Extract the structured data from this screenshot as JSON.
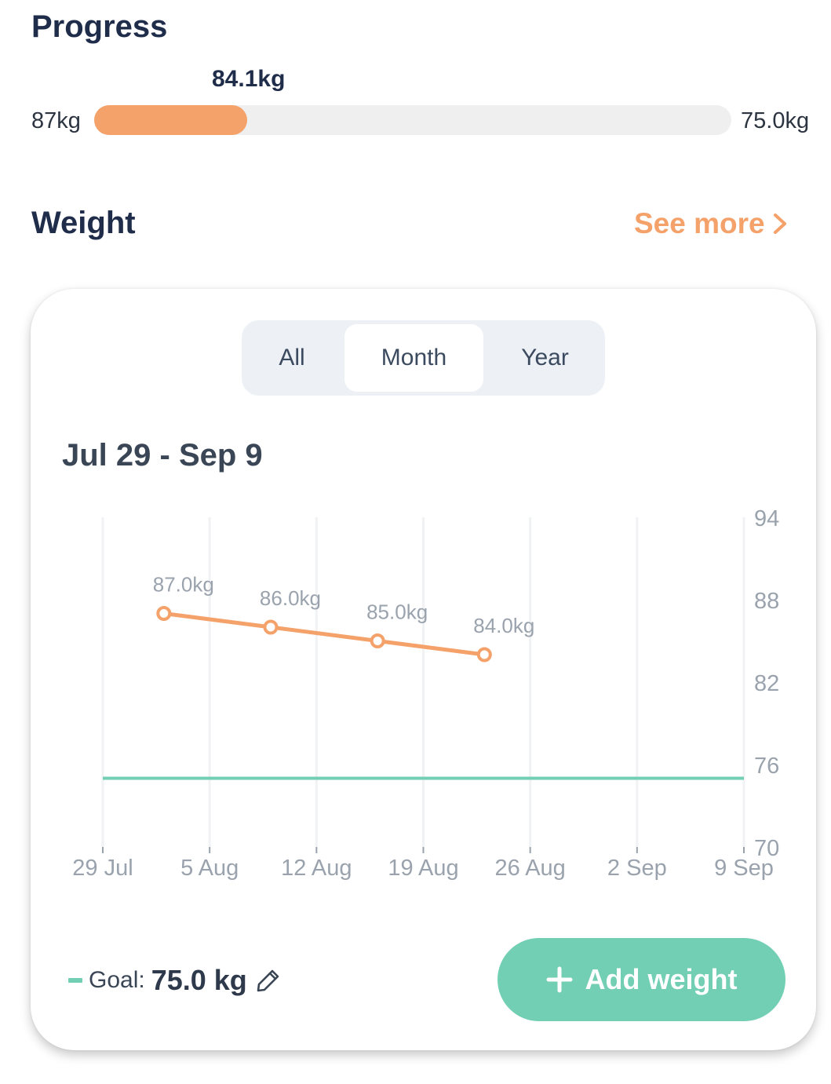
{
  "progress": {
    "title": "Progress",
    "current_label": "84.1kg",
    "start_label": "87kg",
    "target_label": "75.0kg",
    "fraction": 0.24,
    "fill_color": "#f4a16a"
  },
  "weight_section": {
    "title": "Weight",
    "see_more_label": "See more",
    "see_more_icon": "chevron-right-icon"
  },
  "tabs": [
    {
      "label": "All",
      "selected": false
    },
    {
      "label": "Month",
      "selected": true
    },
    {
      "label": "Year",
      "selected": false
    }
  ],
  "date_range": "Jul 29 - Sep 9",
  "chart_data": {
    "type": "line",
    "x_ticks": [
      "29 Jul",
      "5 Aug",
      "12 Aug",
      "19 Aug",
      "26 Aug",
      "2 Sep",
      "9 Sep"
    ],
    "y_ticks": [
      94,
      88,
      82,
      76,
      70
    ],
    "ylim": [
      70,
      94
    ],
    "y_axis_side": "right",
    "grid": "vertical",
    "series": [
      {
        "color": "#f4a16a",
        "points": [
          {
            "x": "2 Aug",
            "y": 87.0,
            "label": "87.0kg"
          },
          {
            "x": "9 Aug",
            "y": 86.0,
            "label": "86.0kg"
          },
          {
            "x": "16 Aug",
            "y": 85.0,
            "label": "85.0kg"
          },
          {
            "x": "23 Aug",
            "y": 84.0,
            "label": "84.0kg"
          }
        ]
      }
    ],
    "goal_line": {
      "y": 75.0,
      "color": "#72cfb4"
    }
  },
  "goal": {
    "label": "Goal:",
    "value": "75.0 kg",
    "edit_icon": "pencil-icon",
    "color": "#72cfb4"
  },
  "add_button": {
    "label": "Add weight",
    "icon": "plus-icon",
    "color": "#72cfb4"
  }
}
